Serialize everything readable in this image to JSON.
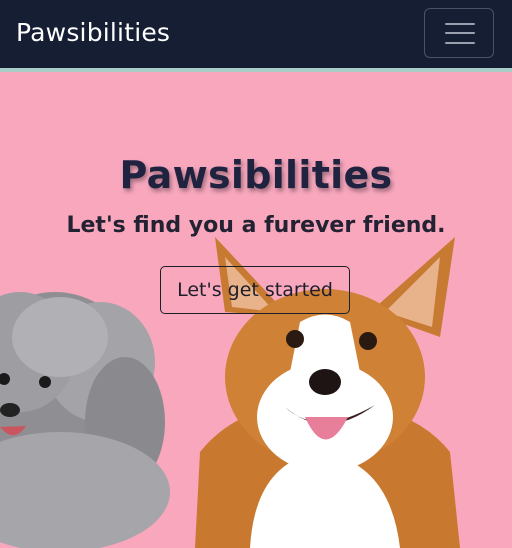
{
  "navbar": {
    "brand": "Pawsibilities",
    "menu_icon": "hamburger-menu-icon"
  },
  "hero": {
    "title": "Pawsibilities",
    "subtitle": "Let's find you a furever friend.",
    "cta_label": "Let's get started",
    "background_color": "#f8a7bd"
  },
  "theme": {
    "nav_bg": "#161e33",
    "accent_stripe": "#a8cdc8"
  }
}
